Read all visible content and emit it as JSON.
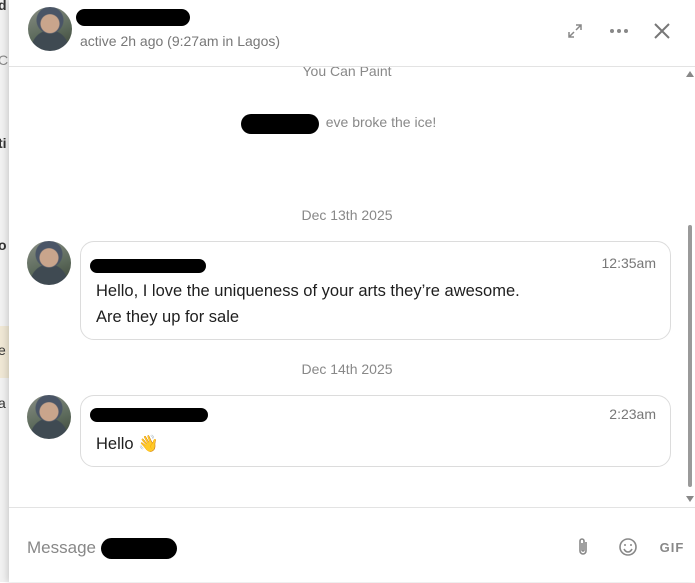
{
  "background": {
    "fragments": [
      "d",
      "C",
      "ti",
      "o",
      "e",
      "a"
    ]
  },
  "header": {
    "status": "active 2h ago (9:27am in Lagos)",
    "icons": [
      "expand-icon",
      "more-icon",
      "close-icon"
    ]
  },
  "conversation": {
    "context_label": "You Can Paint",
    "ice_breaker_suffix": "eve broke the ice!",
    "days": [
      {
        "date": "Dec 13th 2025",
        "time": "12:35am",
        "lines": [
          "Hello, I love the uniqueness of your arts they’re awesome.",
          "Are they up for sale"
        ]
      },
      {
        "date": "Dec 14th 2025",
        "time": "2:23am",
        "lines": [
          "Hello 👋"
        ]
      }
    ]
  },
  "composer": {
    "placeholder": "Message",
    "gif_label": "GIF"
  },
  "colors": {
    "muted_text": "#888888",
    "card_border": "#dcdcdc",
    "redaction": "#000000"
  }
}
